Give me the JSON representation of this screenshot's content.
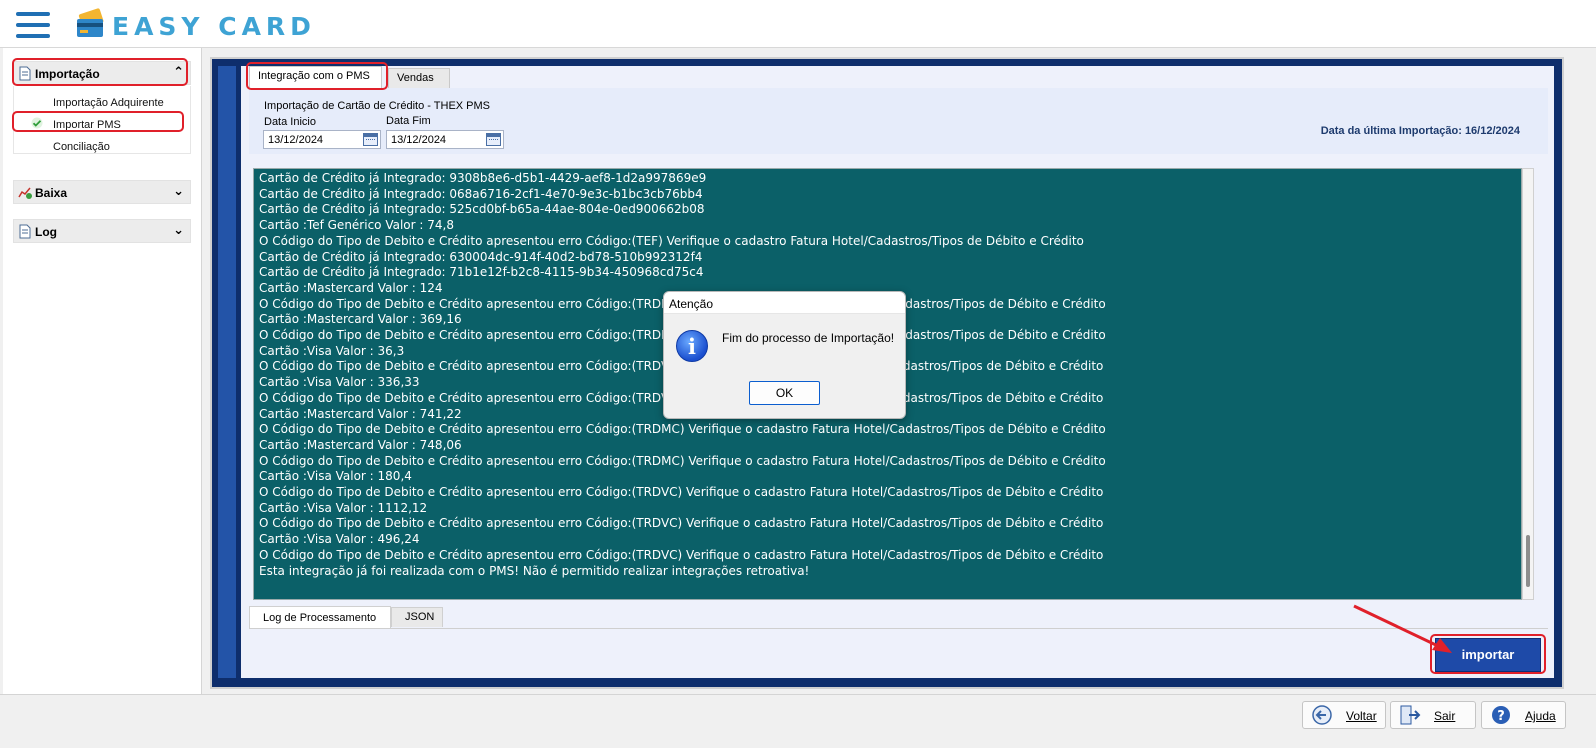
{
  "header": {
    "logo_text": "EASY CARD"
  },
  "sidebar": {
    "sections": [
      {
        "label": "Importação",
        "expanded": true
      },
      {
        "label": "Baixa",
        "expanded": false
      },
      {
        "label": "Log",
        "expanded": false
      }
    ],
    "import_items": [
      "Importação Adquirente",
      "Importar PMS",
      "Conciliação"
    ],
    "active_item": "Importar PMS"
  },
  "tabs": [
    "Integração com o PMS",
    "Vendas"
  ],
  "active_tab": "Integração com o PMS",
  "import_panel": {
    "title": "Importação de Cartão de Crédito - THEX PMS",
    "start_label": "Data Inicio",
    "start_value": "13/12/2024",
    "end_label": "Data Fim",
    "end_value": "13/12/2024",
    "last_import": "Data da última Importação: 16/12/2024"
  },
  "log_lines": [
    "Cartão de Crédito já Integrado: 9308b8e6-d5b1-4429-aef8-1d2a997869e9",
    "Cartão de Crédito já Integrado: 068a6716-2cf1-4e70-9e3c-b1bc3cb76bb4",
    "Cartão de Crédito já Integrado: 525cd0bf-b65a-44ae-804e-0ed900662b08",
    "Cartão :Tef Genérico Valor : 74,8",
    "O Código do Tipo de Debito e Crédito apresentou erro Código:(TEF) Verifique o cadastro Fatura Hotel/Cadastros/Tipos de Débito e Crédito",
    "Cartão de Crédito já Integrado: 630004dc-914f-40d2-bd78-510b992312f4",
    "Cartão de Crédito já Integrado: 71b1e12f-b2c8-4115-9b34-450968cd75c4",
    "Cartão :Mastercard Valor : 124",
    "O Código do Tipo de Debito e Crédito apresentou erro Código:(TRDMC) Verifique o cadastro Fatura Hotel/Cadastros/Tipos de Débito e Crédito",
    "Cartão :Mastercard Valor : 369,16",
    "O Código do Tipo de Debito e Crédito apresentou erro Código:(TRDMC) Verifique o cadastro Fatura Hotel/Cadastros/Tipos de Débito e Crédito",
    "Cartão :Visa Valor : 36,3",
    "O Código do Tipo de Debito e Crédito apresentou erro Código:(TRDVC) Verifique o cadastro Fatura Hotel/Cadastros/Tipos de Débito e Crédito",
    "Cartão :Visa Valor : 336,33",
    "O Código do Tipo de Debito e Crédito apresentou erro Código:(TRDVC) Verifique o cadastro Fatura Hotel/Cadastros/Tipos de Débito e Crédito",
    "Cartão :Mastercard Valor : 741,22",
    "O Código do Tipo de Debito e Crédito apresentou erro Código:(TRDMC) Verifique o cadastro Fatura Hotel/Cadastros/Tipos de Débito e Crédito",
    "Cartão :Mastercard Valor : 748,06",
    "O Código do Tipo de Debito e Crédito apresentou erro Código:(TRDMC) Verifique o cadastro Fatura Hotel/Cadastros/Tipos de Débito e Crédito",
    "Cartão :Visa Valor : 180,4",
    "O Código do Tipo de Debito e Crédito apresentou erro Código:(TRDVC) Verifique o cadastro Fatura Hotel/Cadastros/Tipos de Débito e Crédito",
    "Cartão :Visa Valor : 1112,12",
    "O Código do Tipo de Debito e Crédito apresentou erro Código:(TRDVC) Verifique o cadastro Fatura Hotel/Cadastros/Tipos de Débito e Crédito",
    "Cartão :Visa Valor : 496,24",
    "O Código do Tipo de Debito e Crédito apresentou erro Código:(TRDVC) Verifique o cadastro Fatura Hotel/Cadastros/Tipos de Débito e Crédito",
    "Esta integração já foi realizada com o PMS! Não é permitido realizar integrações retroativa!"
  ],
  "bottom_tabs": [
    "Log de Processamento",
    "JSON"
  ],
  "import_button": "importar",
  "dialog": {
    "title": "Atenção",
    "message": "Fim do processo de Importação!",
    "ok": "OK",
    "icon": "info-icon"
  },
  "footer": {
    "back": "Voltar",
    "exit": "Sair",
    "help": "Ajuda"
  },
  "colors": {
    "log_background": "#0b6068",
    "frame": "#0e2e6c",
    "button": "#1e4aa8",
    "highlight": "#e0202a",
    "logo": "#3ea3d4"
  }
}
